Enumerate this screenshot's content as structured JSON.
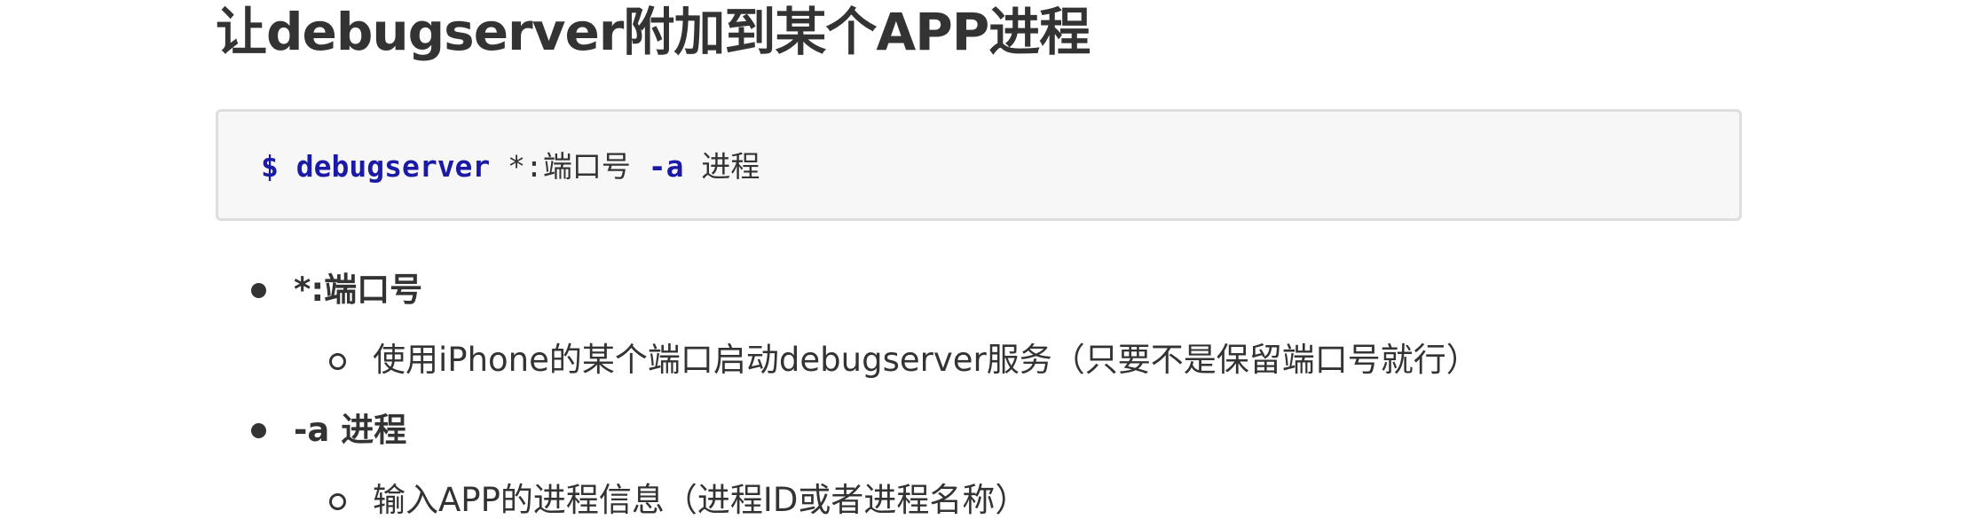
{
  "heading": "让debugserver附加到某个APP进程",
  "code": {
    "prompt": "$",
    "command": "debugserver",
    "port_arg": "*:端口号",
    "flag": "-a",
    "process_arg": "进程"
  },
  "list": [
    {
      "label": "*:端口号",
      "sub": "使用iPhone的某个端口启动debugserver服务（只要不是保留端口号就行）"
    },
    {
      "label": "-a 进程",
      "sub": "输入APP的进程信息（进程ID或者进程名称）"
    }
  ]
}
